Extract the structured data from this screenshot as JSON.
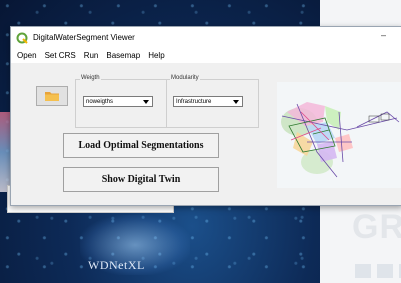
{
  "window": {
    "title": "DigitalWaterSegment Viewer",
    "minimize_glyph": "–"
  },
  "menu": [
    "Open",
    "Set CRS",
    "Run",
    "Basemap",
    "Help"
  ],
  "weigth": {
    "legend": "Weigth",
    "selected": "noweigths"
  },
  "modularity": {
    "legend": "Modularity",
    "selected": "Infrastructure"
  },
  "buttons": {
    "load": "Load Optimal Segmentations",
    "twin": "Show Digital Twin"
  },
  "background": {
    "logo_text": "WDNetXL",
    "right_text": "GR"
  },
  "icons": {
    "app": "qgis-icon",
    "open": "folder-icon"
  },
  "colors": {
    "folder": "#e8a33a",
    "qgis_green": "#5fa33a",
    "map_bg": "#f3f6f8"
  }
}
